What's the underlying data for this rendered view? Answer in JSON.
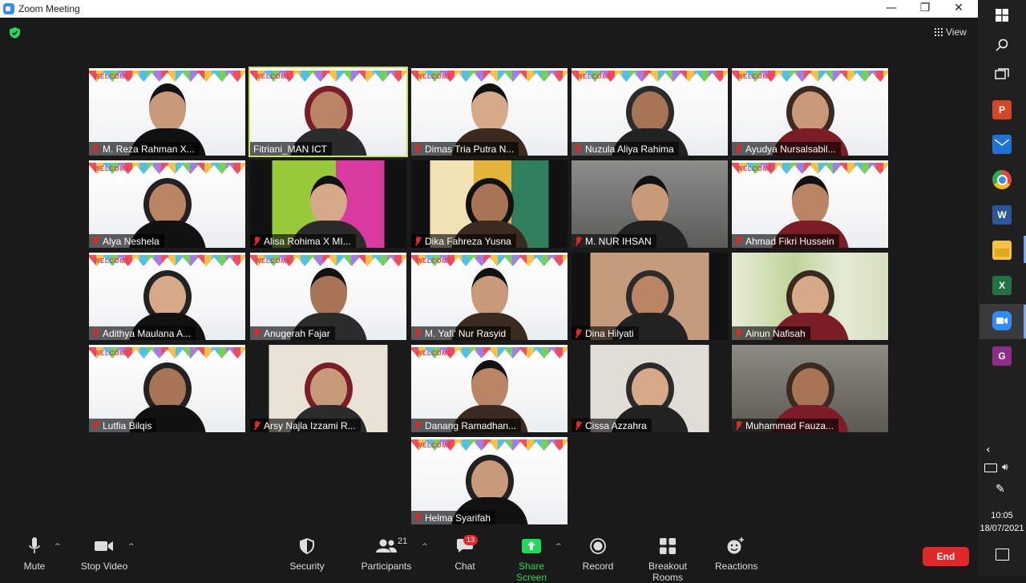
{
  "window": {
    "title": "Zoom Meeting",
    "minimize": "—",
    "maximize": "❐",
    "close": "✕"
  },
  "view_button": {
    "label": "View"
  },
  "participants": [
    {
      "name": "M. Reza Rahman X...",
      "bg": "poster",
      "muted": true,
      "active": false
    },
    {
      "name": "Fitriani_MAN ICT",
      "bg": "poster",
      "muted": false,
      "active": true
    },
    {
      "name": "Dimas Tria Putra N...",
      "bg": "poster",
      "muted": true,
      "active": false
    },
    {
      "name": "Nuzula Aliya Rahima",
      "bg": "poster",
      "muted": true,
      "active": false
    },
    {
      "name": "Ayudya Nursalsabil...",
      "bg": "poster",
      "muted": true,
      "active": false
    },
    {
      "name": "Alya Neshela",
      "bg": "poster",
      "muted": true,
      "active": false
    },
    {
      "name": "Alisa Rohima X MI...",
      "bg": "green",
      "muted": true,
      "active": false
    },
    {
      "name": "Dika Fahreza Yusna",
      "bg": "room",
      "muted": true,
      "active": false
    },
    {
      "name": "M. NUR IHSAN",
      "bg": "close",
      "muted": true,
      "active": false
    },
    {
      "name": "Ahmad Fikri Hussein",
      "bg": "poster",
      "muted": true,
      "active": false
    },
    {
      "name": "Adithya Maulana A...",
      "bg": "poster",
      "muted": true,
      "active": false
    },
    {
      "name": "Anugerah Fajar",
      "bg": "poster",
      "muted": true,
      "active": false
    },
    {
      "name": "M. Yafi' Nur Rasyid",
      "bg": "poster",
      "muted": true,
      "active": false
    },
    {
      "name": "Dina Hilyati",
      "bg": "wood",
      "muted": true,
      "active": false
    },
    {
      "name": "Ainun Nafisah",
      "bg": "leaves",
      "muted": true,
      "active": false
    },
    {
      "name": "Lutfia Bilqis",
      "bg": "poster",
      "muted": true,
      "active": false
    },
    {
      "name": "Arsy Najla Izzami R...",
      "bg": "wall",
      "muted": true,
      "active": false
    },
    {
      "name": "Danang Ramadhan...",
      "bg": "poster",
      "muted": true,
      "active": false
    },
    {
      "name": "Cissa Azzahra",
      "bg": "window",
      "muted": true,
      "active": false
    },
    {
      "name": "Muhammad Fauza...",
      "bg": "dim",
      "muted": true,
      "active": false
    },
    {
      "name": "Helma Syarifah",
      "bg": "poster",
      "muted": true,
      "active": false
    }
  ],
  "poster_text": "WELCOME",
  "toolbar": {
    "mute": "Mute",
    "stop_video": "Stop Video",
    "security": "Security",
    "participants": "Participants",
    "participants_count": "21",
    "chat": "Chat",
    "chat_badge": "13",
    "share_screen": "Share Screen",
    "record": "Record",
    "breakout_rooms": "Breakout Rooms",
    "reactions": "Reactions",
    "end": "End"
  },
  "taskbar": {
    "time": "10:05",
    "date": "18/07/2021"
  },
  "colors": {
    "accent_blue": "#2d8cff",
    "share_green": "#23d959",
    "end_red": "#e02828",
    "active_border": "#c8e05a"
  }
}
